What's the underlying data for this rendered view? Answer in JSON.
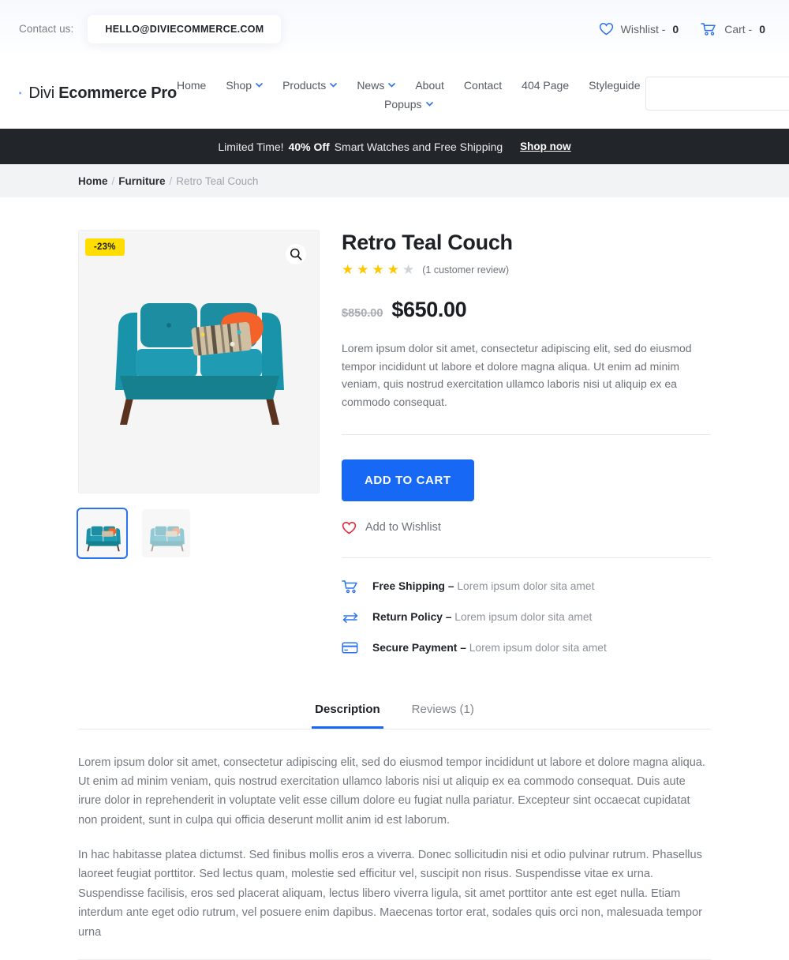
{
  "topbar": {
    "contact_label": "Contact us:",
    "email": "HELLO@DIVIECOMMERCE.COM",
    "wishlist_label": "Wishlist - ",
    "wishlist_count": "0",
    "cart_label": "Cart - ",
    "cart_count": "0"
  },
  "header": {
    "logo_light": "Divi ",
    "logo_bold": "Ecommerce Pro",
    "search_value": "",
    "search_placeholder": "",
    "nav_row1": [
      {
        "label": "Home",
        "dropdown": false
      },
      {
        "label": "Shop",
        "dropdown": true
      },
      {
        "label": "Products",
        "dropdown": true
      },
      {
        "label": "News",
        "dropdown": true
      },
      {
        "label": "About",
        "dropdown": false
      },
      {
        "label": "Contact",
        "dropdown": false
      },
      {
        "label": "404 Page",
        "dropdown": false
      },
      {
        "label": "Styleguide",
        "dropdown": false
      }
    ],
    "nav_row2": [
      {
        "label": "Popups",
        "dropdown": true
      }
    ]
  },
  "promo": {
    "pre": "Limited Time!",
    "bold": "40% Off",
    "post": "Smart Watches and Free Shipping",
    "link": "Shop now"
  },
  "breadcrumb": {
    "home": "Home",
    "category": "Furniture",
    "current": "Retro Teal Couch",
    "separator": "/"
  },
  "product": {
    "title": "Retro Teal Couch",
    "sale_badge": "-23%",
    "stars_filled": 4,
    "stars_total": 5,
    "review_link": "(1 customer review)",
    "price_old": "$850.00",
    "price_new": "$650.00",
    "short_description": "Lorem ipsum dolor sit amet, consectetur adipiscing elit, sed do eiusmod tempor incididunt ut labore et dolore magna aliqua. Ut enim ad minim veniam, quis nostrud exercitation ullamco laboris nisi ut aliquip ex ea commodo consequat.",
    "add_to_cart": "ADD TO CART",
    "wishlist": "Add to Wishlist",
    "features": [
      {
        "icon": "cart-icon",
        "title": "Free Shipping –",
        "text": "Lorem ipsum dolor sita amet"
      },
      {
        "icon": "return-arrows-icon",
        "title": "Return Policy –",
        "text": "Lorem ipsum dolor sita amet"
      },
      {
        "icon": "credit-card-icon",
        "title": "Secure Payment –",
        "text": "Lorem ipsum dolor sita amet"
      }
    ]
  },
  "tabs": {
    "items": [
      {
        "label": "Description",
        "active": true
      },
      {
        "label": "Reviews (1)",
        "active": false
      }
    ],
    "description_p1": "Lorem ipsum dolor sit amet, consectetur adipiscing elit, sed do eiusmod tempor incididunt ut labore et dolore magna aliqua. Ut enim ad minim veniam, quis nostrud exercitation ullamco laboris nisi ut aliquip ex ea commodo consequat. Duis aute irure dolor in reprehenderit in voluptate velit esse cillum dolore eu fugiat nulla pariatur. Excepteur sint occaecat cupidatat non proident, sunt in culpa qui officia deserunt mollit anim id est laborum.",
    "description_p2": "In hac habitasse platea dictumst. Sed finibus mollis eros a viverra. Donec sollicitudin nisi et odio pulvinar rutrum. Phasellus laoreet feugiat porttitor. Sed lectus quam, molestie sed efficitur vel, suscipit non risus. Suspendisse vitae ex urna. Suspendisse facilisis, eros sed placerat aliquam, lectus libero viverra ligula, sit amet porttitor ante est eget nulla. Etiam interdum ante eget odio rutrum, vel posuere enim dapibus. Maecenas tortor erat, sodales quis orci non, malesuada tempor urna"
  },
  "colors": {
    "accent_blue": "#1668f5",
    "promo_bar": "#22252a",
    "badge_yellow": "#ffdd00",
    "star_gold": "#ffc700",
    "wishlist_red": "#e8253c",
    "couch_teal": "#1f8fa4"
  }
}
